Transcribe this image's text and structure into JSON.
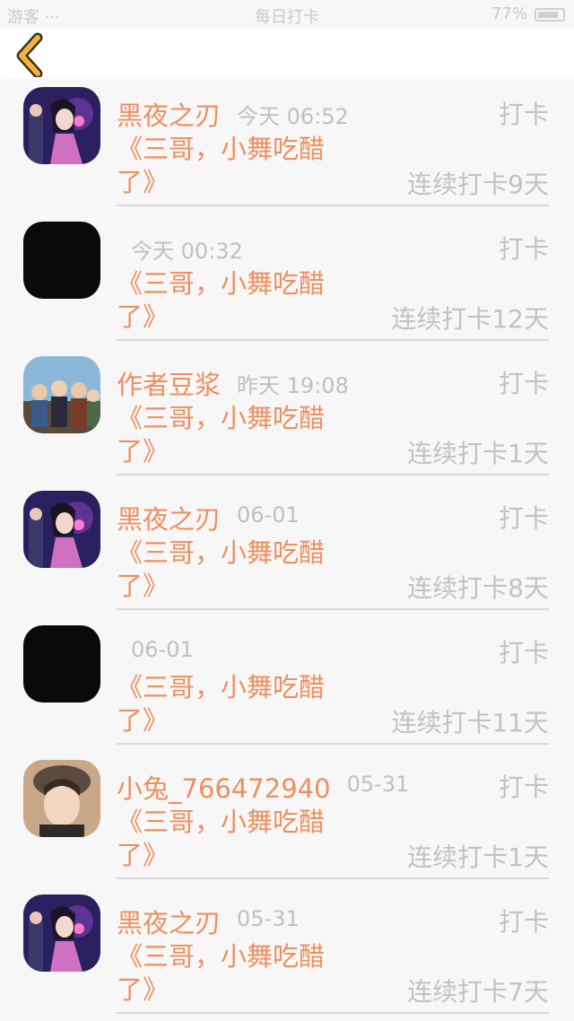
{
  "status_bar": {
    "carrier": "游客 ···",
    "title": "每日打卡",
    "battery": "77%"
  },
  "nav": {
    "back_icon": "chevron-left-icon",
    "accent": "#f3b43b"
  },
  "colors": {
    "accent_orange": "#ee8f5e",
    "muted_gray": "#c0c0c0"
  },
  "checkins": [
    {
      "user": "黑夜之刃",
      "time": "今天 06:52",
      "action": "打卡",
      "title": "《三哥，小舞吃醋了》",
      "streak": "连续打卡9天",
      "avatar": "anime-avatar"
    },
    {
      "user": "",
      "time": "今天 00:32",
      "action": "打卡",
      "title": "《三哥，小舞吃醋了》",
      "streak": "连续打卡12天",
      "avatar": "black-avatar"
    },
    {
      "user": "作者豆浆",
      "time": "昨天 19:08",
      "action": "打卡",
      "title": "《三哥，小舞吃醋了》",
      "streak": "连续打卡1天",
      "avatar": "group-avatar"
    },
    {
      "user": "黑夜之刃",
      "time": "06-01",
      "action": "打卡",
      "title": "《三哥，小舞吃醋了》",
      "streak": "连续打卡8天",
      "avatar": "anime-avatar"
    },
    {
      "user": "",
      "time": "06-01",
      "action": "打卡",
      "title": "《三哥，小舞吃醋了》",
      "streak": "连续打卡11天",
      "avatar": "black-avatar"
    },
    {
      "user": "小兔_766472940",
      "time": "05-31",
      "action": "打卡",
      "title": "《三哥，小舞吃醋了》",
      "streak": "连续打卡1天",
      "avatar": "photo-avatar"
    },
    {
      "user": "黑夜之刃",
      "time": "05-31",
      "action": "打卡",
      "title": "《三哥，小舞吃醋了》",
      "streak": "连续打卡7天",
      "avatar": "anime-avatar"
    }
  ]
}
